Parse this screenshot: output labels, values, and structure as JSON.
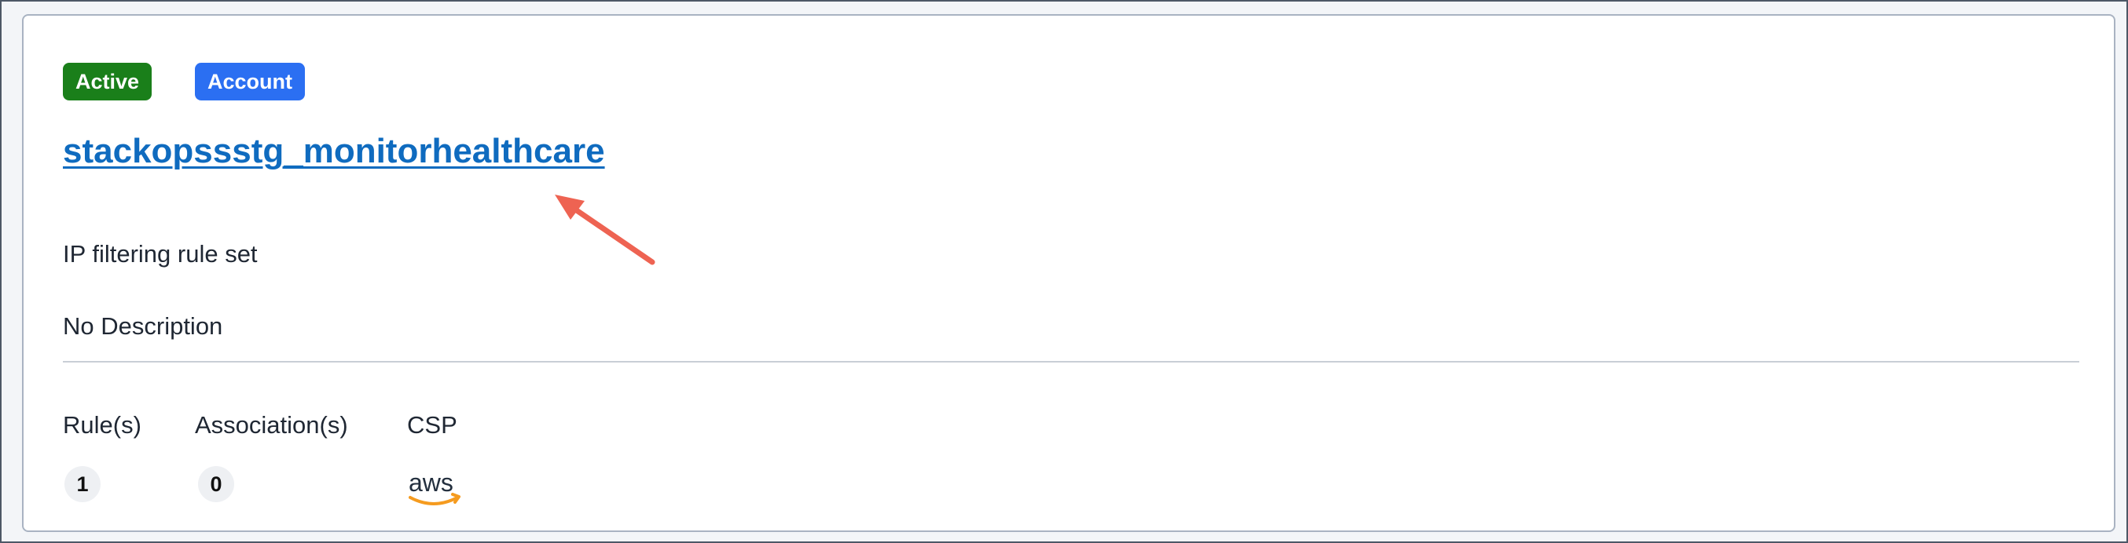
{
  "badges": {
    "status": "Active",
    "scope": "Account"
  },
  "ruleset": {
    "name": "stackopssstg_monitorhealthcare",
    "type": "IP filtering rule set",
    "description": "No Description"
  },
  "stats": {
    "rules_label": "Rule(s)",
    "rules_count": "1",
    "associations_label": "Association(s)",
    "associations_count": "0",
    "csp_label": "CSP",
    "csp_value": "aws"
  },
  "colors": {
    "active_badge": "#1a7f1a",
    "account_badge": "#2b6ff2",
    "link": "#0f6bbf",
    "annotation_arrow": "#ee6352",
    "aws_smile": "#f59b1f"
  },
  "icons": {
    "csp_logo": "aws-logo-icon",
    "annotation": "red-arrow-icon"
  }
}
